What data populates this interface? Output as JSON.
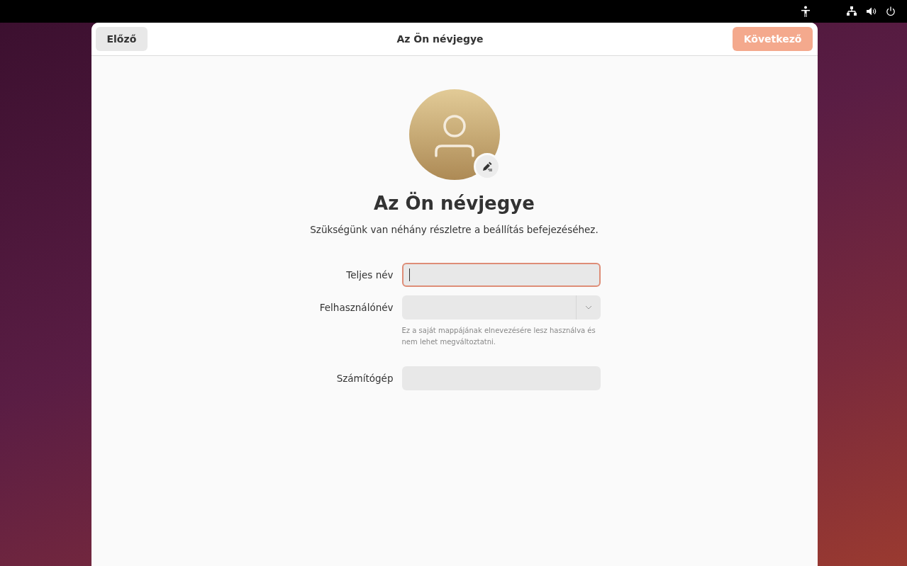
{
  "header": {
    "back_button": "Előző",
    "title": "Az Ön névjegye",
    "next_button": {
      "label": "Következő",
      "disabled": true
    }
  },
  "heading": "Az Ön névjegye",
  "subtitle": "Szükségünk van néhány részletre a beállítás befejezéséhez.",
  "fields": [
    {
      "label": "Teljes név",
      "kind": "text",
      "focused": true
    },
    {
      "label": "Felhasználónév",
      "kind": "combo",
      "focused": false,
      "hint": "Ez a saját mappájának elnevezésére lesz használva és nem lehet megváltoztatni."
    },
    {
      "label": "Számítógép",
      "kind": "text",
      "focused": false
    }
  ]
}
